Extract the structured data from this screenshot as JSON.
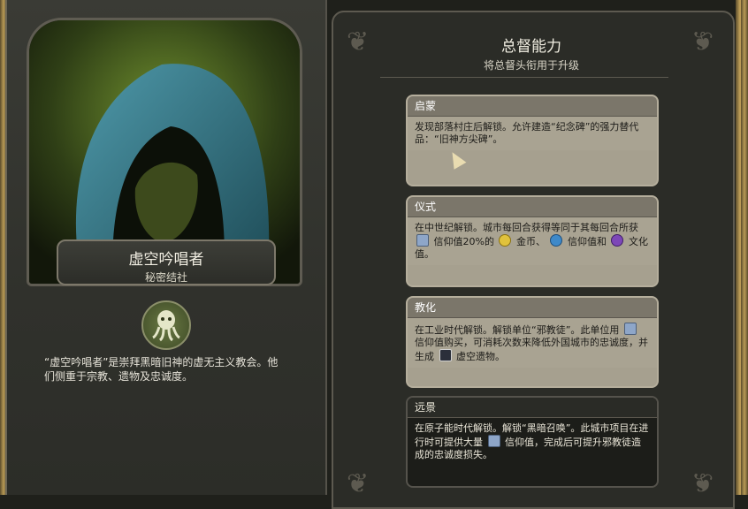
{
  "leader": {
    "name": "虚空吟唱者",
    "subtitle": "秘密结社",
    "description": "“虚空吟唱者”是崇拜黑暗旧神的虚无主义教会。他们侧重于宗教、遗物及忠诚度。"
  },
  "panel": {
    "title": "总督能力",
    "subtitle": "将总督头衔用于升级"
  },
  "abilities": [
    {
      "name": "启蒙",
      "text_1": "发现部落村庄后解锁。允许建造“纪念碑”的强力替代品：“旧神方尖碑”。"
    },
    {
      "name": "仪式",
      "text_1": "在中世纪解锁。城市每回合获得等同于其每回合所获",
      "text_2": "信仰值20%的",
      "text_3": "金币、",
      "text_4": "信仰值和",
      "text_5": "文化值。"
    },
    {
      "name": "教化",
      "text_1": "在工业时代解锁。解锁单位“邪教徒”。此单位用",
      "text_2": "信仰值购买，可消耗次数来降低外国城市的忠诚度，并生成",
      "text_3": "虚空遗物。"
    },
    {
      "name": "远景",
      "text_1": "在原子能时代解锁。解锁“黑暗召唤”。此城市项目在进行时可提供大量",
      "text_2": "信仰值，完成后可提升邪教徒造成的忠诚度损失。"
    }
  ],
  "icons": {
    "faith": "faith-icon",
    "gold": "gold-icon",
    "science": "science-icon",
    "culture": "culture-icon",
    "relic": "relic-icon",
    "cult": "cthulhu-icon"
  },
  "colors": {
    "card_unlocked": "#a6a08f",
    "card_locked": "#1c1d19",
    "hood": "#3f7f8f",
    "background_glow": "#5a7a2a"
  }
}
